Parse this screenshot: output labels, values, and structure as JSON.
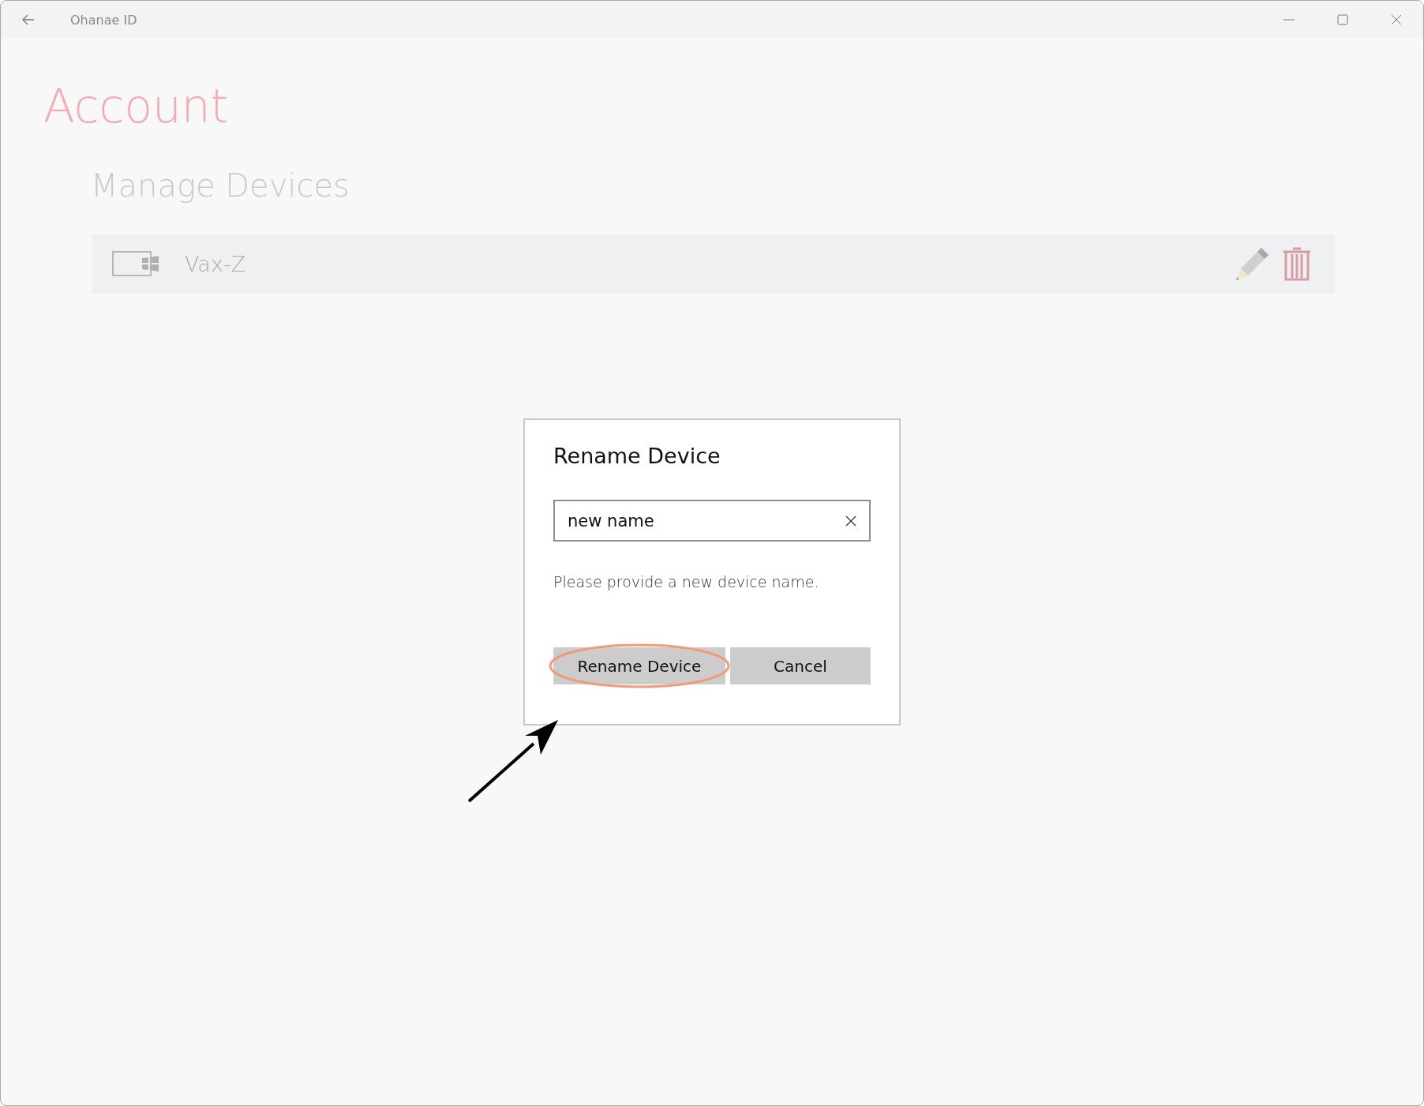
{
  "window": {
    "title": "Ohanae ID"
  },
  "page": {
    "title": "Account",
    "section": "Manage Devices"
  },
  "devices": [
    {
      "name": "Vax-Z"
    }
  ],
  "dialog": {
    "title": "Rename Device",
    "field": {
      "value": "new name"
    },
    "message": "Please provide a new device name.",
    "buttons": [
      {
        "label": "Rename Device",
        "highlighted": true
      },
      {
        "label": "Cancel",
        "highlighted": false
      }
    ],
    "arrow_callout": true
  }
}
